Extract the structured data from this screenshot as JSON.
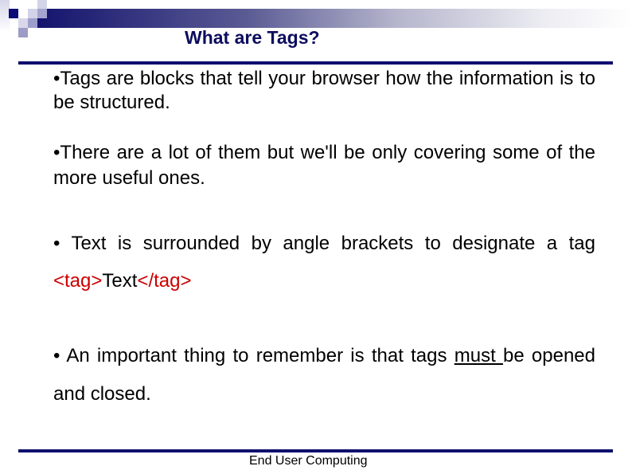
{
  "slide": {
    "title": "What are Tags?",
    "bullets": [
      {
        "bullet": "•",
        "text": "Tags are blocks that tell your browser how the information is to be structured."
      },
      {
        "bullet": "•",
        "text": "There are a lot of them but we'll be only covering some of the more useful ones."
      },
      {
        "bullet": "•",
        "text_before": " Text is surrounded by angle brackets to designate a tag ",
        "code_open": "<tag>",
        "code_inner": "Text",
        "code_close": "</tag>"
      },
      {
        "bullet": "•",
        "text_before": " An important thing to remember is that tags ",
        "emphasis": "must ",
        "text_after": "be opened and closed."
      }
    ],
    "footer": "End User Computing"
  },
  "colors": {
    "title": "#0d0d5e",
    "rule": "#0f0f6e",
    "code": "#cc0000",
    "body": "#000000"
  }
}
